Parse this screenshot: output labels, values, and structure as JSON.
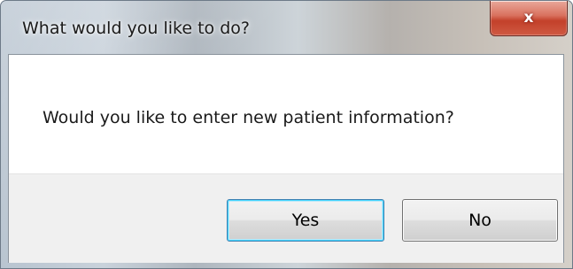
{
  "dialog": {
    "title": "What would you like to do?",
    "close_glyph": "x",
    "message": "Would you like to enter new patient information?",
    "buttons": {
      "yes_label": "Yes",
      "no_label": "No"
    }
  },
  "colors": {
    "close_button": "#c7432c",
    "button_face": "#e6e6e6",
    "button_area": "#f0f0f0",
    "default_button_focus": "#48d7ff"
  },
  "icons": {
    "close": "close-icon"
  }
}
